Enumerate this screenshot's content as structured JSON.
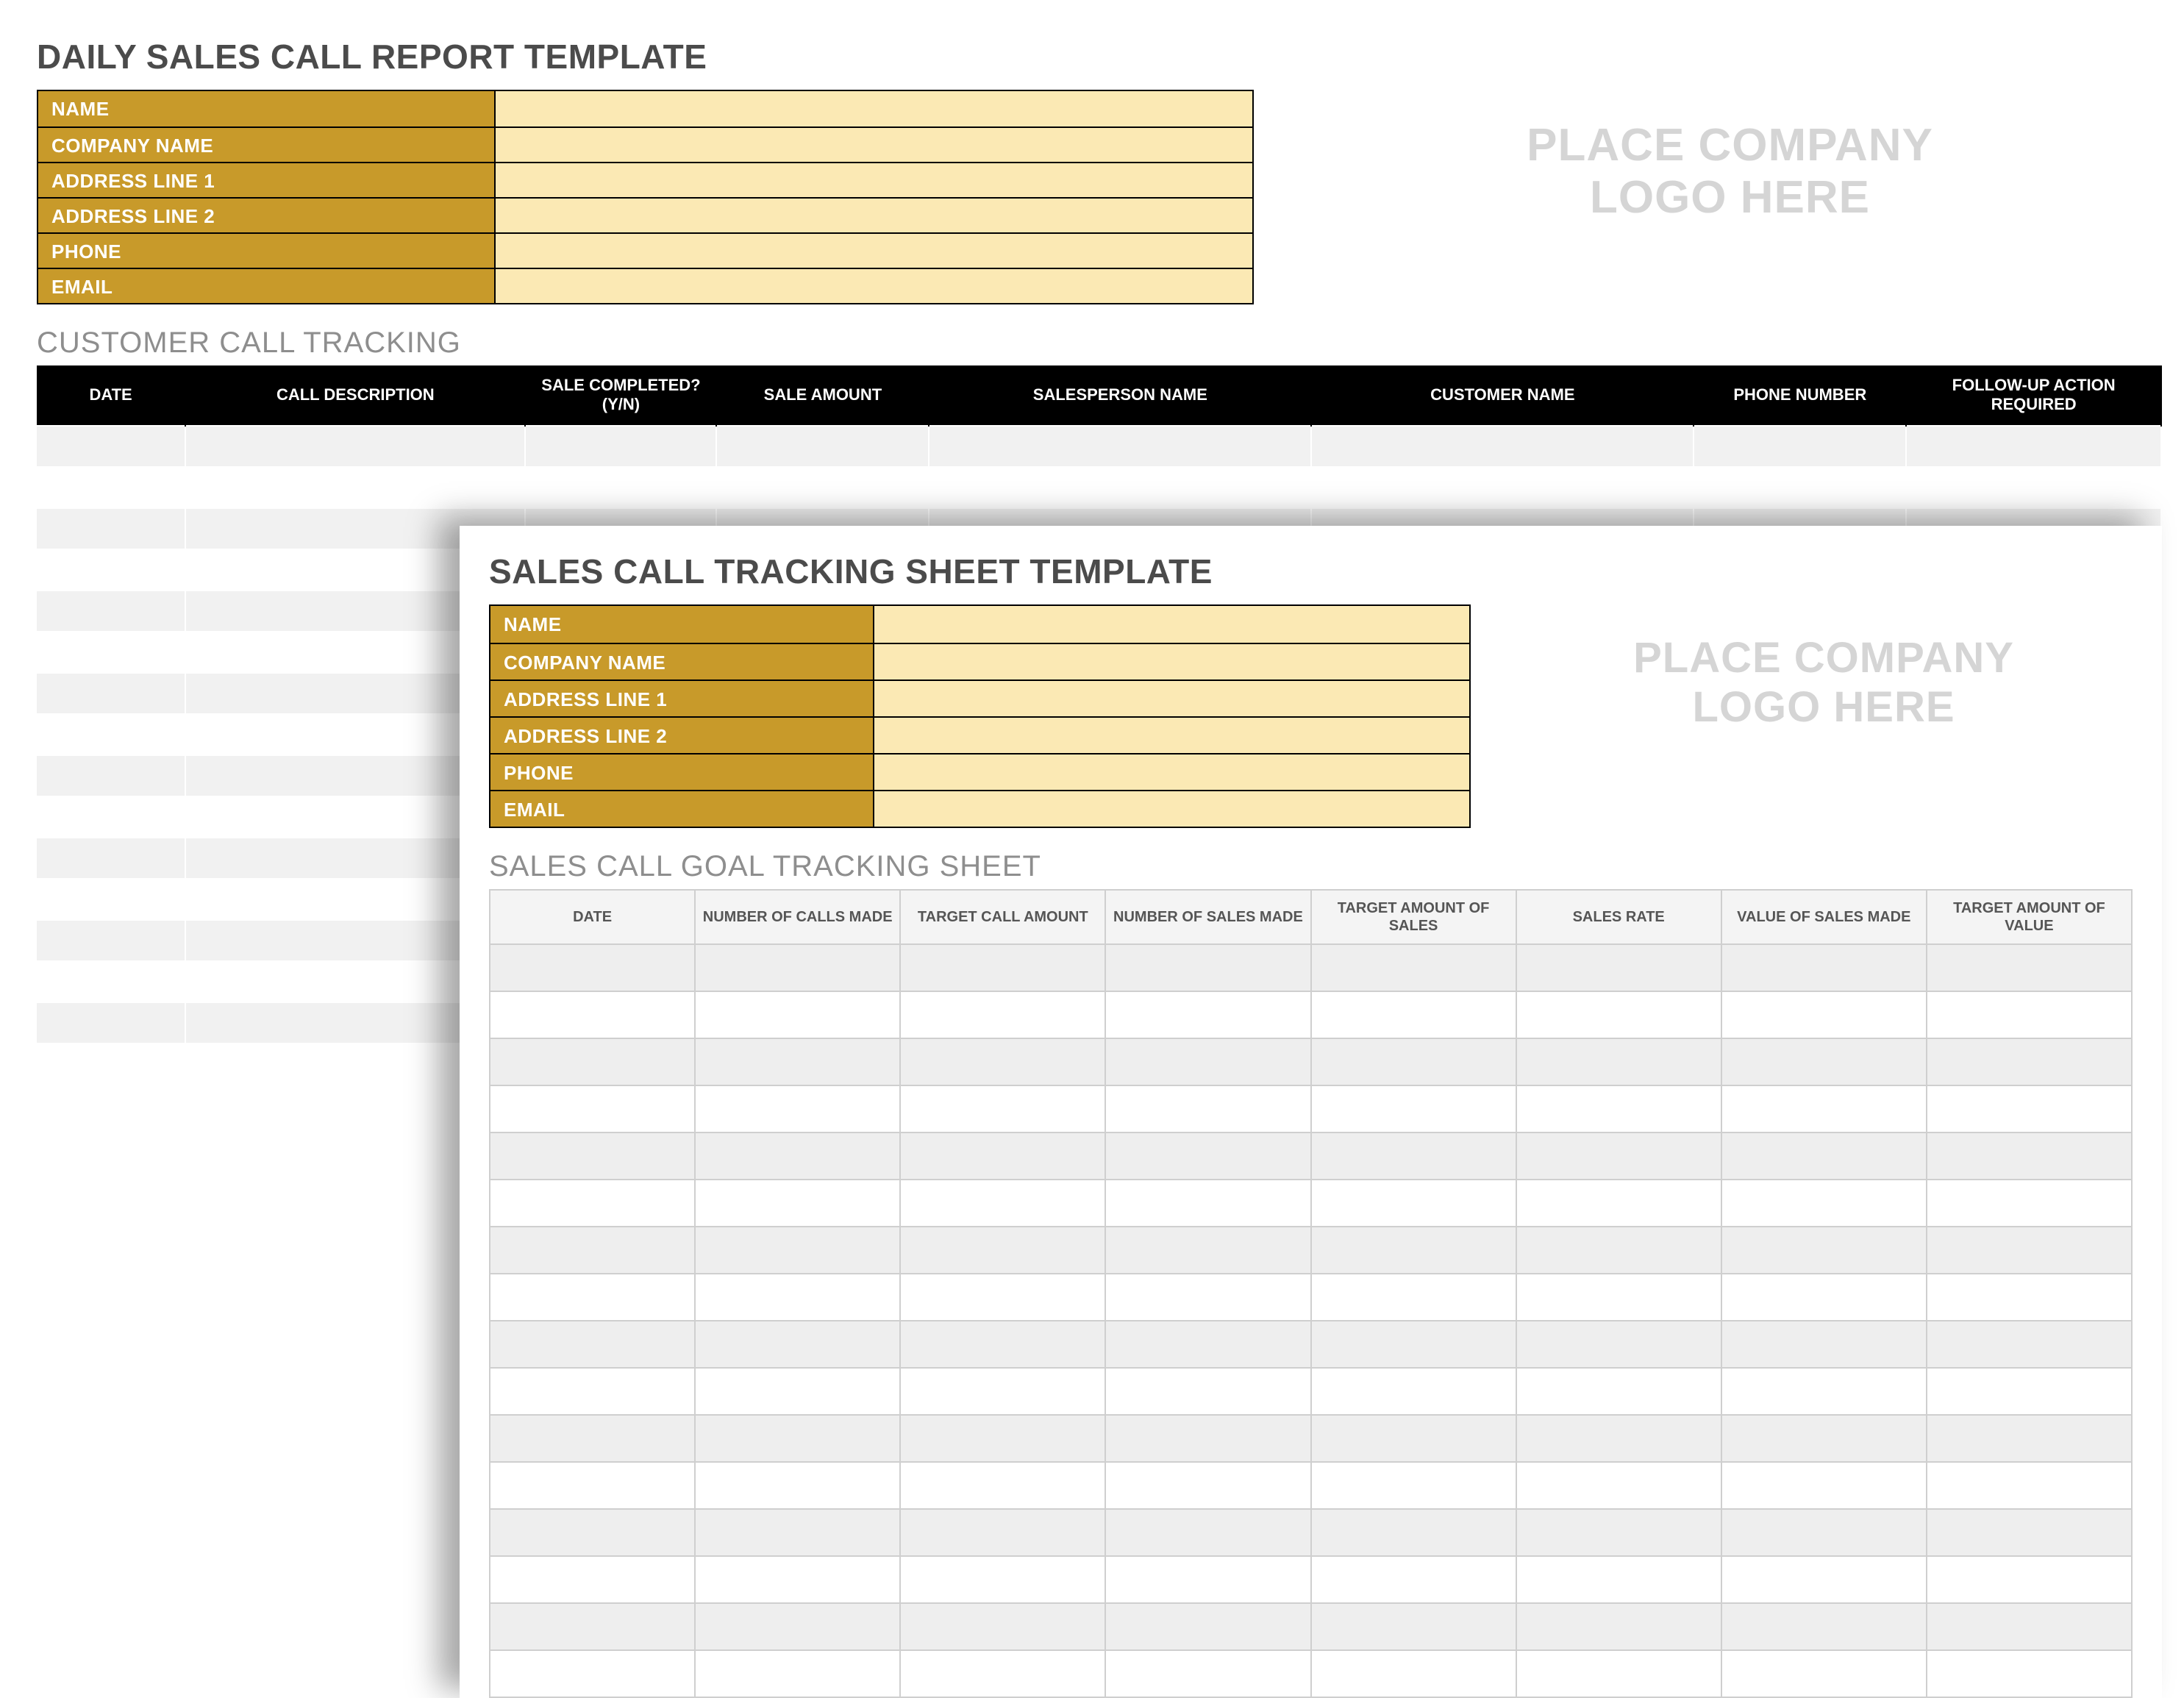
{
  "back": {
    "title": "DAILY SALES CALL REPORT TEMPLATE",
    "logo_placeholder": "PLACE COMPANY\nLOGO HERE",
    "info_rows": [
      {
        "label": "NAME",
        "value": ""
      },
      {
        "label": "COMPANY NAME",
        "value": ""
      },
      {
        "label": "ADDRESS LINE 1",
        "value": ""
      },
      {
        "label": "ADDRESS LINE 2",
        "value": ""
      },
      {
        "label": "PHONE",
        "value": ""
      },
      {
        "label": "EMAIL",
        "value": ""
      }
    ],
    "subtitle": "CUSTOMER CALL TRACKING",
    "columns": [
      "DATE",
      "CALL DESCRIPTION",
      "SALE COMPLETED? (Y/N)",
      "SALE AMOUNT",
      "SALESPERSON NAME",
      "CUSTOMER NAME",
      "PHONE NUMBER",
      "FOLLOW-UP ACTION REQUIRED"
    ],
    "col_widths": [
      "7%",
      "16%",
      "9%",
      "10%",
      "18%",
      "18%",
      "10%",
      "12%"
    ],
    "row_count": 16
  },
  "front": {
    "title": "SALES CALL TRACKING SHEET TEMPLATE",
    "logo_placeholder": "PLACE COMPANY\nLOGO HERE",
    "info_rows": [
      {
        "label": "NAME",
        "value": ""
      },
      {
        "label": "COMPANY NAME",
        "value": ""
      },
      {
        "label": "ADDRESS LINE 1",
        "value": ""
      },
      {
        "label": "ADDRESS LINE 2",
        "value": ""
      },
      {
        "label": "PHONE",
        "value": ""
      },
      {
        "label": "EMAIL",
        "value": ""
      }
    ],
    "subtitle": "SALES CALL GOAL TRACKING SHEET",
    "columns": [
      "DATE",
      "NUMBER OF CALLS MADE",
      "TARGET CALL AMOUNT",
      "NUMBER OF SALES MADE",
      "TARGET AMOUNT OF SALES",
      "SALES RATE",
      "VALUE OF SALES MADE",
      "TARGET AMOUNT OF VALUE"
    ],
    "row_count": 16
  }
}
